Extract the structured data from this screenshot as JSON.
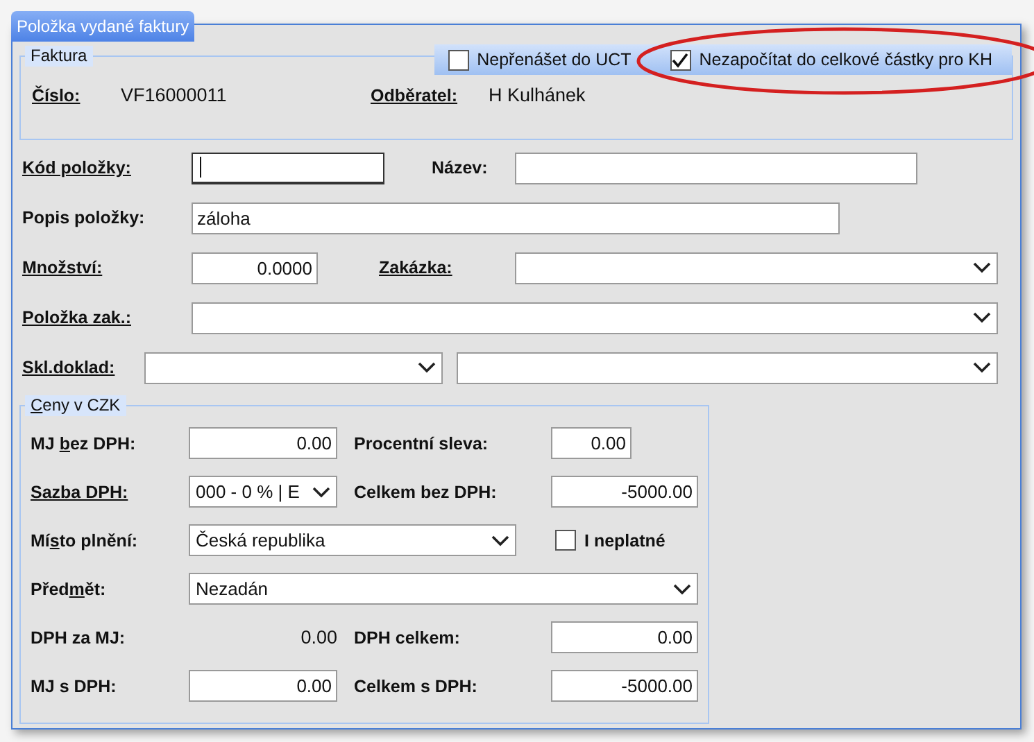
{
  "window": {
    "title": "Položka vydané faktury"
  },
  "invoice_group": {
    "title": "Faktura",
    "fields": [
      {
        "label": "Číslo:",
        "value": "VF16000011"
      },
      {
        "label": "Odběratel:",
        "value": "H Kulhánek"
      }
    ]
  },
  "options": [
    {
      "label": "Nepřenášet do UCT",
      "checked": false,
      "highlighted": false
    },
    {
      "label": "Nezapočítat do celkové částky pro KH",
      "checked": true,
      "highlighted": true
    }
  ],
  "item": {
    "code": {
      "label": "Kód položky:",
      "underlined": true,
      "focused": true
    },
    "name": {
      "label": "Název:",
      "underlined": false
    },
    "description": {
      "label": "Popis položky:",
      "underlined": false,
      "value": "záloha"
    },
    "quantity": {
      "label": "Množství:",
      "underlined": true,
      "value": "0.0000"
    },
    "order": {
      "label": "Zakázka:",
      "underlined": true
    },
    "order_item": {
      "label": "Položka zak.:",
      "underlined": true
    },
    "stock_document": {
      "label": "Skl.doklad:",
      "underlined": true
    }
  },
  "prices_group": {
    "title_key": "C",
    "title_rest": "eny v CZK",
    "unit_price": {
      "label_parts": [
        "MJ ",
        "b",
        "ez DPH:"
      ],
      "value": "0.00"
    },
    "discount": {
      "label": "Procentní sleva:",
      "underlined": false,
      "value": "0.00"
    },
    "vat_rate": {
      "label": "Sazba DPH:",
      "underlined": true,
      "value": "000 - 0 % | E"
    },
    "total_net": {
      "label": "Celkem bez DPH:",
      "underlined": false,
      "value": "-5000.00"
    },
    "place": {
      "label_parts": [
        "Mí",
        "s",
        "to plnění:"
      ],
      "value": "Česká republika"
    },
    "include_invalid": {
      "label": "I neplatné",
      "checked": false
    },
    "subject": {
      "label_parts": [
        "Před",
        "m",
        "ět:"
      ],
      "value": "Nezadán"
    },
    "unit_vat": {
      "label": "DPH za MJ:",
      "underlined": false,
      "value": "0.00"
    },
    "total_vat": {
      "label": "DPH celkem:",
      "underlined": false,
      "value": "0.00"
    },
    "unit_gross": {
      "label": "MJ s DPH:",
      "underlined": false,
      "value": "0.00"
    },
    "total_gross": {
      "label": "Celkem s DPH:",
      "underlined": false,
      "value": "-5000.00"
    }
  }
}
